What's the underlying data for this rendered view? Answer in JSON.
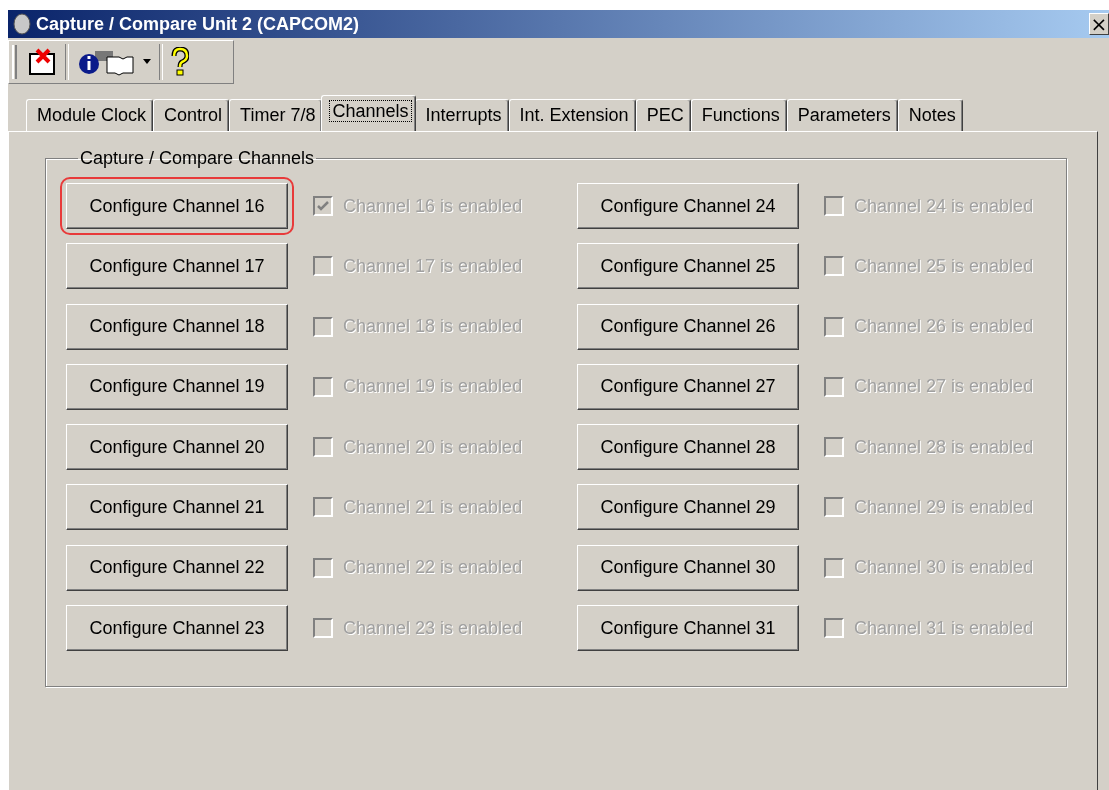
{
  "window": {
    "title": "Capture / Compare Unit 2 (CAPCOM2)",
    "close_label": "×"
  },
  "tabs": [
    {
      "label": "Module Clock",
      "selected": false
    },
    {
      "label": "Control",
      "selected": false
    },
    {
      "label": "Timer 7/8",
      "selected": false
    },
    {
      "label": "Channels",
      "selected": true
    },
    {
      "label": "Interrupts",
      "selected": false
    },
    {
      "label": "Int. Extension",
      "selected": false
    },
    {
      "label": "PEC",
      "selected": false
    },
    {
      "label": "Functions",
      "selected": false
    },
    {
      "label": "Parameters",
      "selected": false
    },
    {
      "label": "Notes",
      "selected": false
    }
  ],
  "group": {
    "title": "Capture / Compare Channels"
  },
  "channels": [
    {
      "button": "Configure Channel 16",
      "label": "Channel 16 is enabled",
      "checked": true,
      "disabled": true,
      "highlighted": true
    },
    {
      "button": "Configure Channel 17",
      "label": "Channel 17 is enabled",
      "checked": false,
      "disabled": true,
      "highlighted": false
    },
    {
      "button": "Configure Channel 18",
      "label": "Channel 18 is enabled",
      "checked": false,
      "disabled": true,
      "highlighted": false
    },
    {
      "button": "Configure Channel 19",
      "label": "Channel 19 is enabled",
      "checked": false,
      "disabled": true,
      "highlighted": false
    },
    {
      "button": "Configure Channel 20",
      "label": "Channel 20 is enabled",
      "checked": false,
      "disabled": true,
      "highlighted": false
    },
    {
      "button": "Configure Channel 21",
      "label": "Channel 21 is enabled",
      "checked": false,
      "disabled": true,
      "highlighted": false
    },
    {
      "button": "Configure Channel 22",
      "label": "Channel 22 is enabled",
      "checked": false,
      "disabled": true,
      "highlighted": false
    },
    {
      "button": "Configure Channel 23",
      "label": "Channel 23 is enabled",
      "checked": false,
      "disabled": true,
      "highlighted": false
    },
    {
      "button": "Configure Channel 24",
      "label": "Channel 24 is enabled",
      "checked": false,
      "disabled": true,
      "highlighted": false
    },
    {
      "button": "Configure Channel 25",
      "label": "Channel 25 is enabled",
      "checked": false,
      "disabled": true,
      "highlighted": false
    },
    {
      "button": "Configure Channel 26",
      "label": "Channel 26 is enabled",
      "checked": false,
      "disabled": true,
      "highlighted": false
    },
    {
      "button": "Configure Channel 27",
      "label": "Channel 27 is enabled",
      "checked": false,
      "disabled": true,
      "highlighted": false
    },
    {
      "button": "Configure Channel 28",
      "label": "Channel 28 is enabled",
      "checked": false,
      "disabled": true,
      "highlighted": false
    },
    {
      "button": "Configure Channel 29",
      "label": "Channel 29 is enabled",
      "checked": false,
      "disabled": true,
      "highlighted": false
    },
    {
      "button": "Configure Channel 30",
      "label": "Channel 30 is enabled",
      "checked": false,
      "disabled": true,
      "highlighted": false
    },
    {
      "button": "Configure Channel 31",
      "label": "Channel 31 is enabled",
      "checked": false,
      "disabled": true,
      "highlighted": false
    }
  ]
}
